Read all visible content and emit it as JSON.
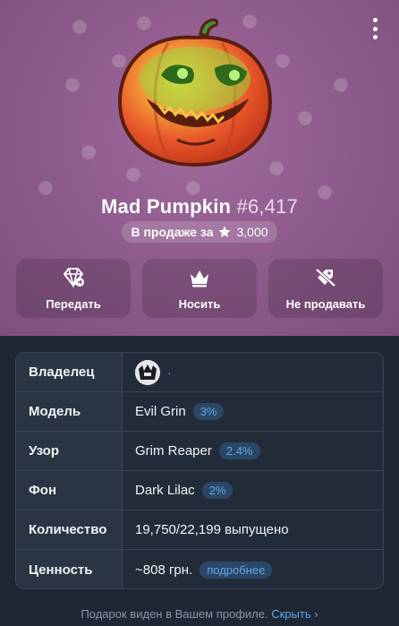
{
  "gift": {
    "name": "Mad Pumpkin",
    "number": "#6,417"
  },
  "sale": {
    "label": "В продаже за",
    "price": "3,000",
    "star_icon": "star-icon"
  },
  "actions": [
    {
      "label": "Передать",
      "icon": "gem-transfer-icon"
    },
    {
      "label": "Носить",
      "icon": "crown-icon"
    },
    {
      "label": "Не продавать",
      "icon": "unlist-tag-icon"
    }
  ],
  "details": {
    "owner_label": "Владелец",
    "owner_value": "·",
    "model_label": "Модель",
    "model_value": "Evil Grin",
    "model_rarity": "3%",
    "pattern_label": "Узор",
    "pattern_value": "Grim Reaper",
    "pattern_rarity": "2.4%",
    "background_label": "Фон",
    "background_value": "Dark Lilac",
    "background_rarity": "2%",
    "quantity_label": "Количество",
    "quantity_value": "19,750/22,199 выпущено",
    "value_label": "Ценность",
    "value_value": "~808 грн.",
    "value_more": "подробнее"
  },
  "footer": {
    "text": "Подарок виден в Вашем профиле.",
    "hide": "Скрыть ›"
  },
  "colors": {
    "hero_bg": "#8c5a8a",
    "panel_bg": "#1e2733",
    "accent": "#5ea7e8"
  }
}
